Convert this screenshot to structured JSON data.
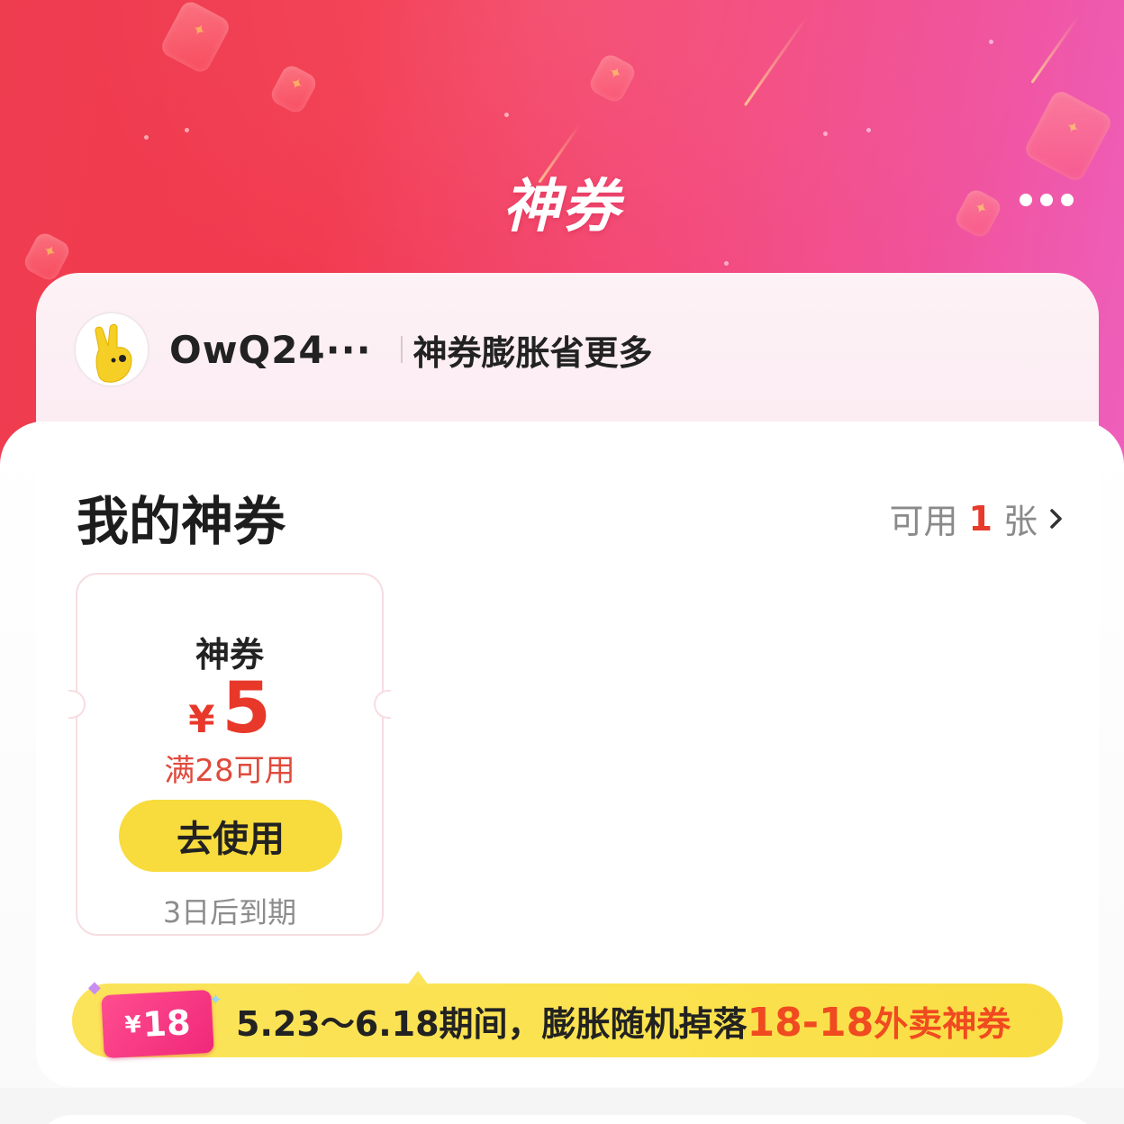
{
  "header": {
    "title": "神券",
    "more_icon": "more-dots-icon"
  },
  "user": {
    "name": "OwQ24···",
    "slogan": "神券膨胀省更多",
    "avatar_icon": "yellow-hand-avatar-icon"
  },
  "my_coupons": {
    "title": "我的神券",
    "available_prefix": "可用",
    "available_count": "1",
    "available_suffix": "张",
    "chevron_icon": "chevron-right-icon"
  },
  "coupons": [
    {
      "name": "神券",
      "currency": "¥",
      "amount": "5",
      "condition": "满28可用",
      "button_label": "去使用",
      "expiry": "3日后到期"
    }
  ],
  "promo": {
    "ticket_currency": "¥",
    "ticket_amount": "18",
    "text_prefix": "5.23～6.18期间，膨胀随机掉落",
    "highlight": "18-18",
    "text_suffix": "外卖神券"
  },
  "colors": {
    "brand_red": "#e8382a",
    "button_yellow": "#f8db3c",
    "hero_start": "#ef3d50",
    "hero_end": "#ee5fbc"
  }
}
